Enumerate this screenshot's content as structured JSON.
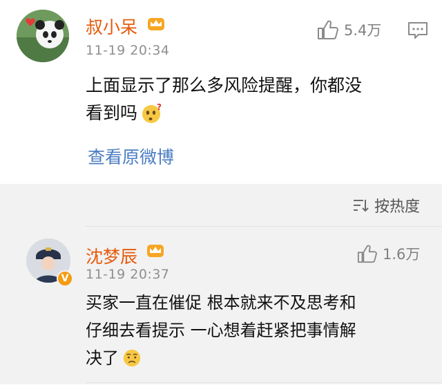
{
  "post": {
    "author": "叔小呆",
    "time": "11-19 20:34",
    "likes": "5.4万",
    "text_line1": "上面显示了那么多风险提醒，你都没",
    "text_line2": "看到吗",
    "view_original": "查看原微博"
  },
  "sort": {
    "label": "按热度"
  },
  "comment": {
    "author": "沈梦辰",
    "time": "11-19 20:37",
    "likes": "1.6万",
    "text_line1": "买家一直在催促 根本就来不及思考和",
    "text_line2": "仔细去看提示 一心想着赶紧把事情解",
    "text_line3": "决了"
  },
  "colors": {
    "name": "#e65a0b",
    "link": "#4a7cc1",
    "band": "#f2f2f2"
  },
  "icons": [
    "thumbs-up-icon",
    "comment-icon",
    "sort-icon",
    "crown-badge-icon",
    "thinking-emoji-icon",
    "sad-emoji-icon",
    "verified-badge-icon"
  ]
}
